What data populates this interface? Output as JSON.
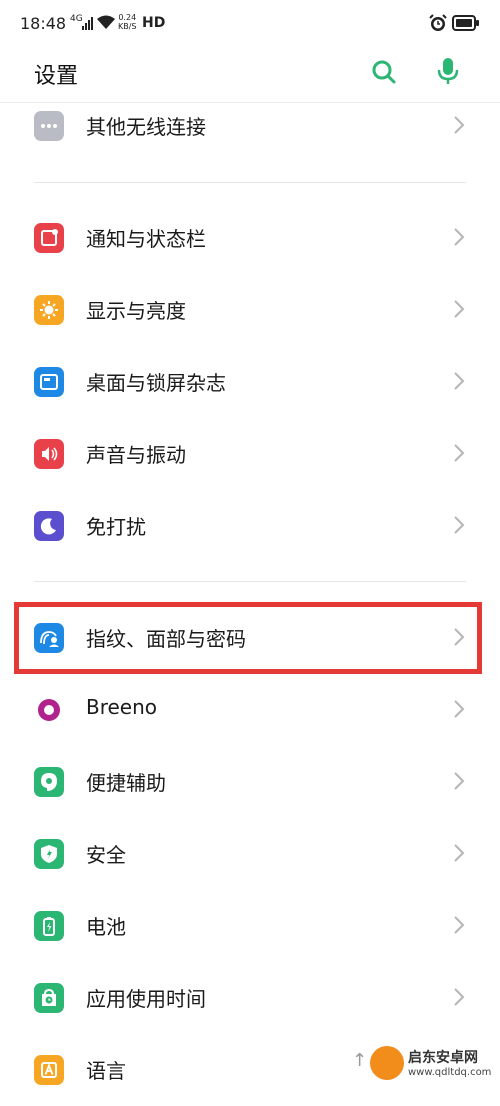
{
  "status_bar": {
    "time": "18:48",
    "network": "4G",
    "speed_value": "0.24",
    "speed_unit": "KB/S",
    "hd": "HD"
  },
  "header": {
    "title": "设置",
    "accent_color": "#2bb673"
  },
  "settings": [
    {
      "label": "其他无线连接",
      "icon": "more-dots-icon",
      "color": "#b9bcc4"
    },
    {
      "label": "通知与状态栏",
      "icon": "notification-icon",
      "color": "#e8414a"
    },
    {
      "label": "显示与亮度",
      "icon": "brightness-icon",
      "color": "#f6a623"
    },
    {
      "label": "桌面与锁屏杂志",
      "icon": "wallpaper-icon",
      "color": "#1e88e5"
    },
    {
      "label": "声音与振动",
      "icon": "speaker-icon",
      "color": "#e8414a"
    },
    {
      "label": "免打扰",
      "icon": "moon-icon",
      "color": "#5b4fcf"
    },
    {
      "label": "指纹、面部与密码",
      "icon": "fingerprint-face-icon",
      "color": "#1e88e5"
    },
    {
      "label": "Breeno",
      "icon": "breeno-icon",
      "color": "#b0228c"
    },
    {
      "label": "便捷辅助",
      "icon": "assist-icon",
      "color": "#2bb673"
    },
    {
      "label": "安全",
      "icon": "shield-icon",
      "color": "#2bb673"
    },
    {
      "label": "电池",
      "icon": "battery-icon",
      "color": "#2bb673"
    },
    {
      "label": "应用使用时间",
      "icon": "app-time-icon",
      "color": "#2bb673"
    },
    {
      "label": "语言",
      "icon": "language-icon",
      "color": "#f6a623"
    }
  ],
  "watermark": {
    "brand": "启东安卓网",
    "url": "www.qdltdq.com"
  }
}
